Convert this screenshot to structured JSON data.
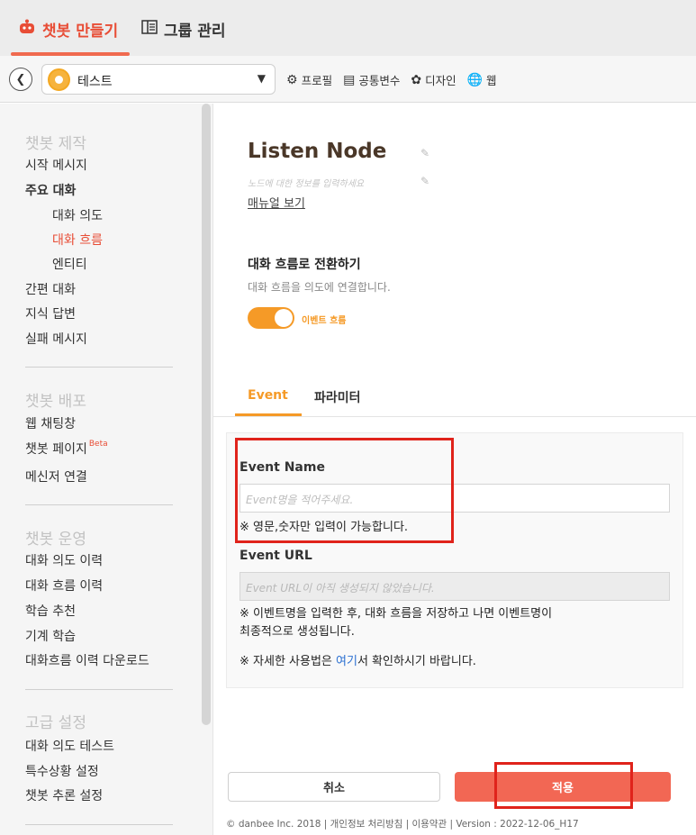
{
  "top_tabs": [
    {
      "label": "챗봇 만들기",
      "icon": "robot-icon",
      "active": true
    },
    {
      "label": "그룹 관리",
      "icon": "group-icon",
      "active": false
    }
  ],
  "toolbar": {
    "bot_name": "테스트",
    "links": [
      {
        "label": "프로필",
        "icon": "gear-icon"
      },
      {
        "label": "공통변수",
        "icon": "variable-icon"
      },
      {
        "label": "디자인",
        "icon": "palette-icon"
      },
      {
        "label": "웹",
        "icon": "globe-icon"
      }
    ]
  },
  "sidebar": {
    "sections": [
      {
        "title": "챗봇 제작",
        "items": [
          "시작 메시지",
          "주요 대화",
          "대화 의도",
          "대화 흐름",
          "엔티티",
          "간편 대화",
          "지식 답변",
          "실패 메시지"
        ]
      },
      {
        "title": "챗봇 배포",
        "items": [
          "웹 채팅창",
          "챗봇 페이지",
          "메신저 연결"
        ],
        "beta": "Beta"
      },
      {
        "title": "챗봇 운영",
        "items": [
          "대화 의도 이력",
          "대화 흐름 이력",
          "학습 추천",
          "기계 학습",
          "대화흐름 이력 다운로드"
        ]
      },
      {
        "title": "고급 설정",
        "items": [
          "대화 의도 테스트",
          "특수상황 설정",
          "챗봇 추론 설정"
        ]
      }
    ],
    "active_item": "대화 흐름"
  },
  "node": {
    "title": "Listen Node",
    "description_placeholder": "노드에 대한 정보를 입력하세요",
    "manual_link": "매뉴얼 보기"
  },
  "switch": {
    "title": "대화 흐름로 전환하기",
    "subtitle": "대화 흐름을 의도에 연결합니다.",
    "toggle_label": "이벤트 흐름",
    "on": true
  },
  "tabs": [
    {
      "label": "Event",
      "active": true
    },
    {
      "label": "파라미터",
      "active": false
    }
  ],
  "form": {
    "event_name_label": "Event Name",
    "event_name_placeholder": "Event명을 적어주세요.",
    "event_name_note": "※ 영문,숫자만 입력이 가능합니다.",
    "event_url_label": "Event URL",
    "event_url_placeholder": "Event URL이 아직 생성되지 않았습니다.",
    "event_url_note_1": "※ 이벤트명을 입력한 후, 대화 흐름을 저장하고 나면 이벤트명이",
    "event_url_note_2": "최종적으로 생성됩니다.",
    "usage_note_pre": "※ 자세한 사용법은 ",
    "usage_note_link": "여기",
    "usage_note_post": "서 확인하시기 바랍니다."
  },
  "buttons": {
    "cancel": "취소",
    "apply": "적용"
  },
  "footer": "© danbee Inc. 2018 | 개인정보 처리방침 | 이용약관 | Version : 2022-12-06_H17",
  "colors": {
    "accent": "#f59a27",
    "brand_red": "#e84d36",
    "apply_button": "#f26754",
    "highlight_box": "#e0231b"
  }
}
